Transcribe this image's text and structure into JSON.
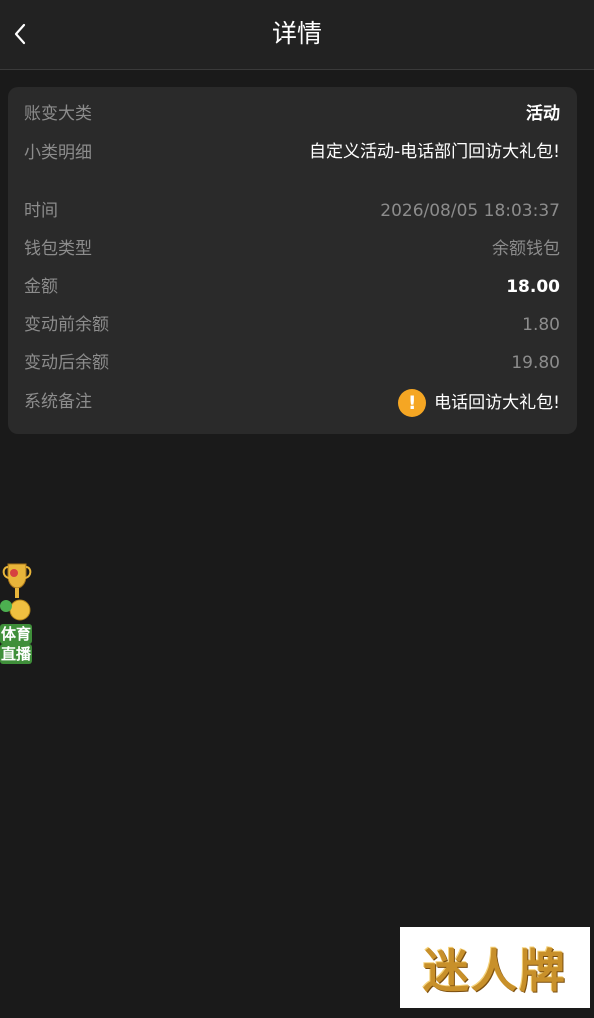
{
  "header": {
    "title": "详情",
    "back_icon": "chevron-left-icon"
  },
  "detail": {
    "category": {
      "label": "账变大类",
      "value": "活动"
    },
    "subcategory": {
      "label": "小类明细",
      "value": "自定义活动-电话部门回访大礼包!"
    },
    "time": {
      "label": "时间",
      "value": "2026/08/05 18:03:37"
    },
    "wallet_type": {
      "label": "钱包类型",
      "value": "余额钱包"
    },
    "amount": {
      "label": "金额",
      "value": "18.00"
    },
    "balance_before": {
      "label": "变动前余额",
      "value": "1.80"
    },
    "balance_after": {
      "label": "变动后余额",
      "value": "19.80"
    },
    "remark": {
      "label": "系统备注",
      "icon": "exclamation-icon",
      "value": "电话回访大礼包!"
    }
  },
  "floating_badge": {
    "icon": "trophy-icon",
    "line1": "体育",
    "line2": "直播"
  },
  "watermark": {
    "text": "迷人牌"
  },
  "colors": {
    "background": "#1a1a1a",
    "header": "#222222",
    "card": "#2a2a2a",
    "label": "#8c8c8c",
    "value": "#ffffff",
    "warning": "#f5a623"
  }
}
